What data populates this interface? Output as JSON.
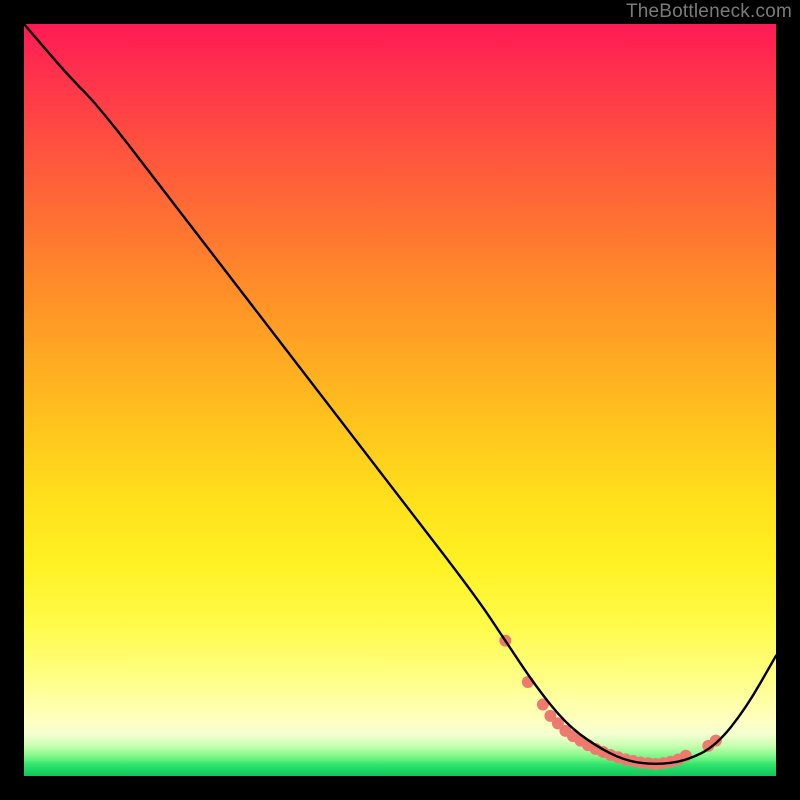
{
  "watermark": "TheBottleneck.com",
  "colors": {
    "background": "#000000",
    "curve": "#000000",
    "markers": "#ee7a6f",
    "watermark_text": "#7a7a7a"
  },
  "chart_data": {
    "type": "line",
    "title": "",
    "xlabel": "",
    "ylabel": "",
    "xlim": [
      0,
      100
    ],
    "ylim": [
      0,
      100
    ],
    "legend": false,
    "grid": false,
    "background_gradient": "vertical rainbow (red→yellow→green)",
    "series": [
      {
        "name": "curve",
        "x": [
          0,
          6,
          10,
          20,
          30,
          40,
          50,
          60,
          64,
          68,
          72,
          76,
          80,
          84,
          88,
          92,
          96,
          100
        ],
        "y": [
          100,
          93,
          89,
          76,
          63,
          50,
          37,
          24,
          18,
          12,
          7,
          4,
          2,
          1.5,
          2,
          4,
          9,
          16
        ],
        "stroke": "#000000",
        "stroke_width": 2
      }
    ],
    "markers": {
      "name": "bottom-cluster",
      "color": "#ee7a6f",
      "radius": 6,
      "points_xy": [
        [
          64,
          18
        ],
        [
          67,
          12.5
        ],
        [
          69,
          9.5
        ],
        [
          70,
          8
        ],
        [
          71,
          7
        ],
        [
          72,
          6
        ],
        [
          73,
          5.3
        ],
        [
          74,
          4.7
        ],
        [
          75,
          4.1
        ],
        [
          76,
          3.6
        ],
        [
          77,
          3.2
        ],
        [
          78,
          2.8
        ],
        [
          79,
          2.5
        ],
        [
          80,
          2.2
        ],
        [
          81,
          2.0
        ],
        [
          82,
          1.8
        ],
        [
          83,
          1.7
        ],
        [
          84,
          1.6
        ],
        [
          85,
          1.7
        ],
        [
          86,
          1.9
        ],
        [
          87,
          2.2
        ],
        [
          88,
          2.7
        ],
        [
          91,
          4.0
        ],
        [
          92,
          4.7
        ]
      ]
    }
  }
}
